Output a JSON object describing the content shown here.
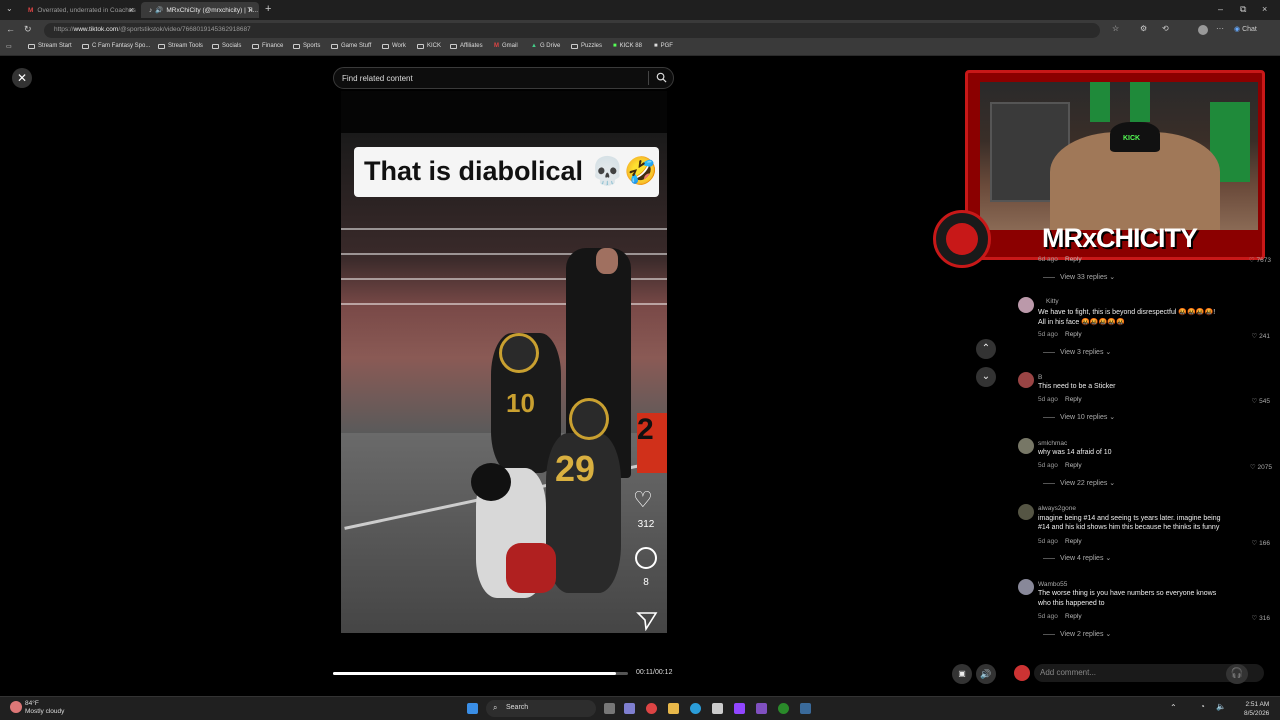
{
  "tabs": [
    {
      "title": "Overrated, underrated in Coaches"
    },
    {
      "title": "MRxChiCity (@mrxchicity) | Ti..."
    }
  ],
  "address": {
    "prefix": "https://",
    "domain": "www.tiktok.com",
    "path": "/@sportstikstok/video/7668019145362918687"
  },
  "toolbar": {
    "chat_label": "Chat"
  },
  "bookmarks": [
    {
      "label": "Stream Start"
    },
    {
      "label": "C Fam Fantasy Spo..."
    },
    {
      "label": "Stream Tools"
    },
    {
      "label": "Socials"
    },
    {
      "label": "Finance"
    },
    {
      "label": "Sports"
    },
    {
      "label": "Game Stuff"
    },
    {
      "label": "Work"
    },
    {
      "label": "KICK"
    },
    {
      "label": "Affiliates"
    },
    {
      "label": "Gmail"
    },
    {
      "label": "G Drive"
    },
    {
      "label": "Puzzles"
    },
    {
      "label": "KICK 88"
    },
    {
      "label": "PGF"
    }
  ],
  "search": {
    "placeholder": "Find related content"
  },
  "video": {
    "caption": "That is diabolical 💀🤣",
    "like_count": "312",
    "comment_count": "8",
    "progress_fraction": 0.96,
    "time": "00:11/00:12",
    "jersey_number_front": "29"
  },
  "stream": {
    "name": "MRxCHICITY",
    "cam_hat": "KICK"
  },
  "comments": [
    {
      "user": "",
      "text": "",
      "ago": "6d ago",
      "reply": "Reply",
      "likes": "7673",
      "view_replies": "View 33 replies"
    },
    {
      "user": "Kitty",
      "text": "We have to fight, this is beyond disrespectful 🤬🤬🤬🤬!",
      "text2": "All in his face 🤬🤬🤬🤬🤬",
      "ago": "5d ago",
      "reply": "Reply",
      "likes": "241",
      "view_replies": "View 3 replies"
    },
    {
      "user": "B",
      "text": "This need to be a Sticker",
      "ago": "5d ago",
      "reply": "Reply",
      "likes": "545",
      "view_replies": "View 10 replies"
    },
    {
      "user": "smlchmac",
      "text": "why was 14 afraid of 10",
      "ago": "5d ago",
      "reply": "Reply",
      "likes": "2075",
      "view_replies": "View 22 replies"
    },
    {
      "user": "always2gone",
      "text": "imagine being #14 and seeing ts years later. imagine being",
      "text2": "#14 and his kid shows him this because he thinks its funny",
      "ago": "5d ago",
      "reply": "Reply",
      "likes": "166",
      "view_replies": "View 4 replies"
    },
    {
      "user": "Wambo55",
      "text": "The worse thing is you have numbers so everyone knows",
      "text2": "who this happened to",
      "ago": "5d ago",
      "reply": "Reply",
      "likes": "316",
      "view_replies": "View 2 replies"
    }
  ],
  "comment_box": {
    "placeholder": "Add comment..."
  },
  "taskbar": {
    "weather_temp": "84°F",
    "weather_desc": "Mostly cloudy",
    "search_label": "Search",
    "time": "2:51 AM",
    "date": "8/5/2026"
  }
}
